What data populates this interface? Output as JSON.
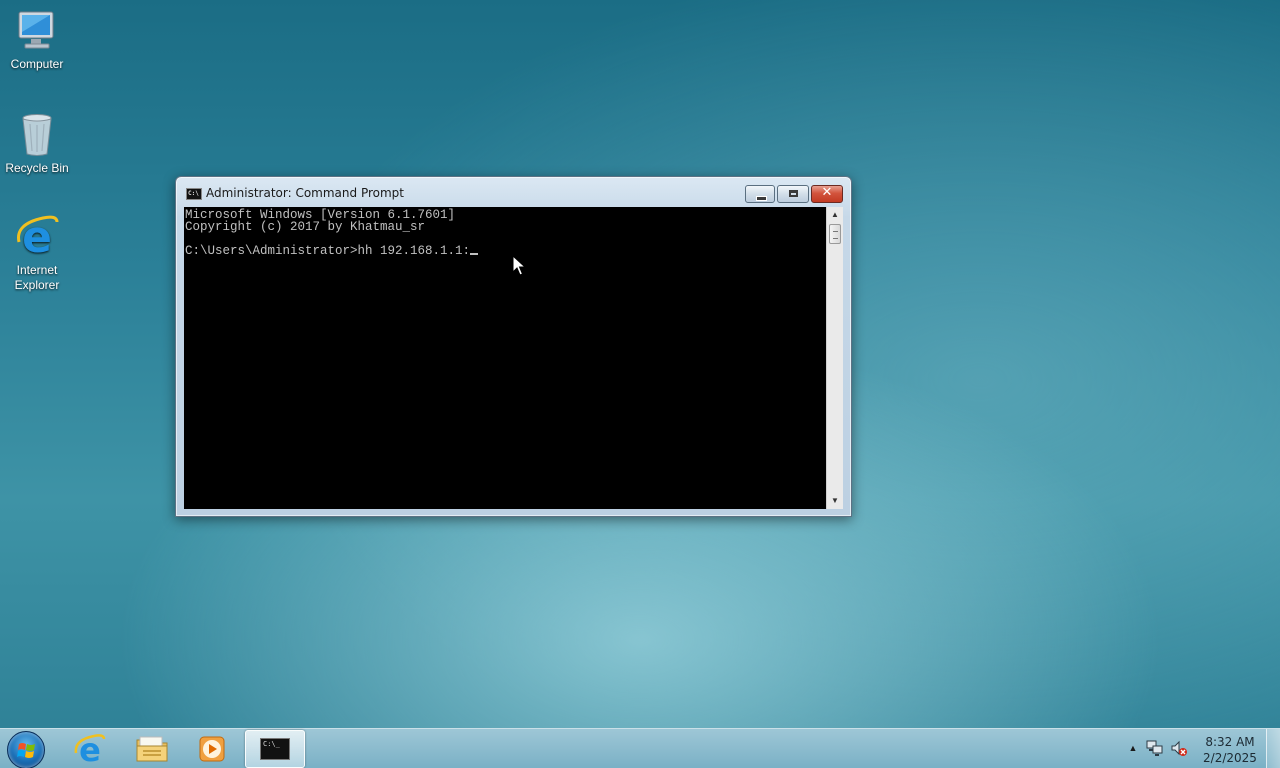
{
  "desktop": {
    "icons": [
      {
        "label": "Computer",
        "icon": "computer-icon"
      },
      {
        "label": "Recycle Bin",
        "icon": "recycle-bin-icon"
      },
      {
        "label": "Internet\nExplorer",
        "icon": "internet-explorer-icon"
      }
    ]
  },
  "window": {
    "title": "Administrator: Command Prompt",
    "icon": "cmd-icon",
    "controls": {
      "minimize": "minimize-icon",
      "maximize": "maximize-icon",
      "close": "✕"
    },
    "console": {
      "lines": [
        "Microsoft Windows [Version 6.1.7601]",
        "Copyright (c) 2017 by Khatmau_sr",
        "",
        "C:\\Users\\Administrator>hh 192.168.1.1:"
      ],
      "text_color": "#c0c0c0",
      "background": "#000000"
    }
  },
  "taskbar": {
    "pinned": [
      {
        "name": "Internet Explorer",
        "icon": "internet-explorer-icon"
      },
      {
        "name": "Windows Explorer",
        "icon": "folder-icon"
      },
      {
        "name": "Windows Media Player",
        "icon": "media-player-icon"
      },
      {
        "name": "Command Prompt",
        "icon": "cmd-icon",
        "active": true,
        "glyph": "C:\\_"
      }
    ],
    "tray": {
      "chevron": "▲",
      "network_icon": "network-icon",
      "volume_icon": "volume-muted-icon"
    },
    "clock": {
      "time": "8:32 AM",
      "date": "2/2/2025"
    }
  },
  "colors": {
    "desktop_accent": "#2b8098",
    "close_button": "#c23a22"
  }
}
